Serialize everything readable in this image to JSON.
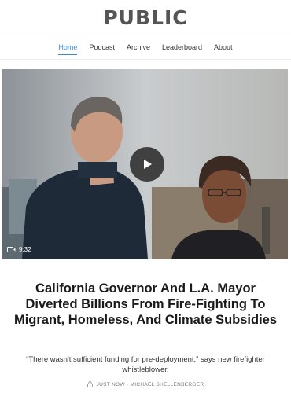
{
  "site": {
    "logo": "PUBLIC"
  },
  "nav": {
    "items": [
      {
        "label": "Home",
        "active": true
      },
      {
        "label": "Podcast",
        "active": false
      },
      {
        "label": "Archive",
        "active": false
      },
      {
        "label": "Leaderboard",
        "active": false
      },
      {
        "label": "About",
        "active": false
      }
    ],
    "accent_color": "#3c8fd6"
  },
  "video": {
    "duration": "9:32",
    "play_icon": "play-icon",
    "camera_icon": "video-camera-icon"
  },
  "article": {
    "title": "California Governor And L.A. Mayor Diverted Billions From Fire-Fighting To Migrant, Homeless, And Climate Subsidies",
    "subtitle": "“There wasn't sufficient funding for pre-deployment,” says new firefighter whistleblower.",
    "byline": "JUST NOW · MICHAEL SHELLENBERGER",
    "lock_icon": "lock-icon"
  }
}
